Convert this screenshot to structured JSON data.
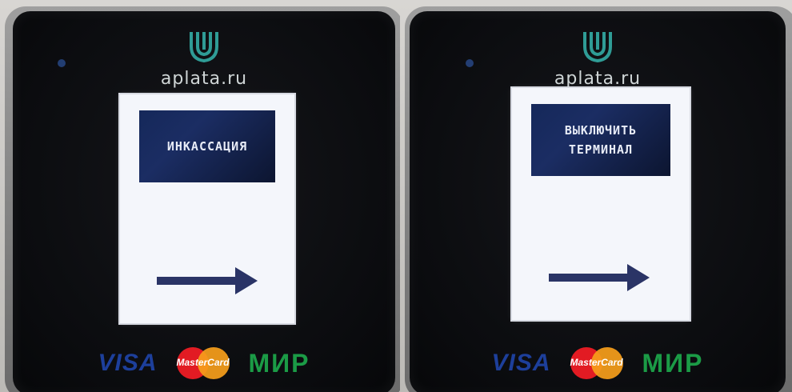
{
  "panels": [
    {
      "brand": "aplata.ru",
      "menu_label": "ИНКАССАЦИЯ",
      "logos": {
        "visa": "VISA",
        "mastercard": "MasterCard",
        "mir": "МИР"
      }
    },
    {
      "brand": "aplata.ru",
      "menu_label": "ВЫКЛЮЧИТЬ\nТЕРМИНАЛ",
      "logos": {
        "visa": "VISA",
        "mastercard": "MasterCard",
        "mir": "МИР"
      }
    }
  ],
  "colors": {
    "brand_logo": "#2f9c96",
    "arrow": "#2a3466",
    "tile": "#15285a",
    "visa": "#1d3f9b",
    "mastercard_red": "#e21b23",
    "mastercard_orange": "#f79e1b",
    "mir_green": "#1b9b46"
  },
  "icons": {
    "brand_logo": "aplata-shield-icon",
    "next": "right-arrow-icon"
  }
}
